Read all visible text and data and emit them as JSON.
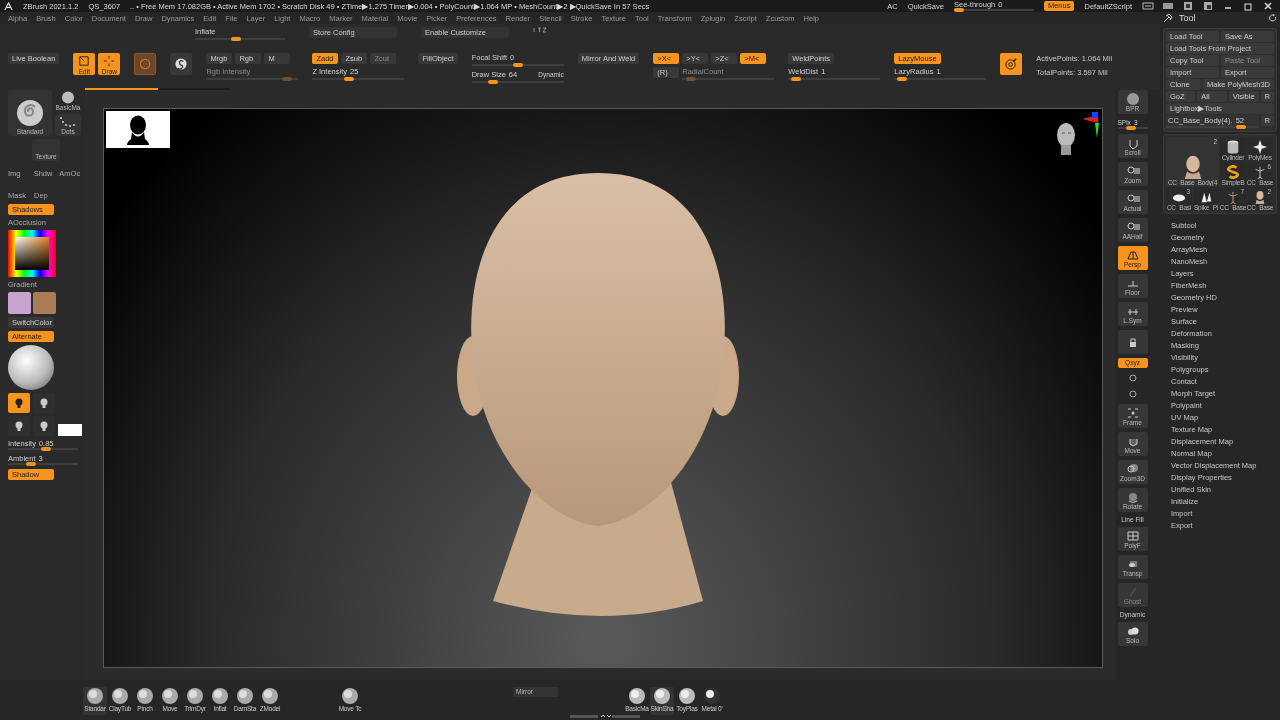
{
  "title_bar": {
    "items": [
      "ZBrush 2021.1.2",
      "QS_3607",
      "‥ • Free Mem 17.082GB • Active Mem 1702 • Scratch Disk 49 • ZTime▶1.275 Timer▶0.004 • PolyCount▶1.064 MP • MeshCount▶2 ▶QuickSave In 57 Secs"
    ],
    "right": [
      "AC",
      "QuickSave"
    ],
    "see_through": {
      "label": "See-through",
      "value": "0",
      "level": 0
    },
    "menus": {
      "label": "Menus",
      "on": true
    },
    "script": "DefaultZScript"
  },
  "menu": [
    "Alpha",
    "Brush",
    "Color",
    "Document",
    "Draw",
    "Dynamics",
    "Edit",
    "File",
    "Layer",
    "Light",
    "Macro",
    "Marker",
    "Material",
    "Movie",
    "Picker",
    "Preferences",
    "Render",
    "Stencil",
    "Stroke",
    "Texture",
    "Tool",
    "Transform",
    "Zplugin",
    "Zscript",
    "Zcustom",
    "Help"
  ],
  "toolbar": {
    "top_row": [
      {
        "kind": "slider",
        "label": "Inflate",
        "level": 0.45,
        "disabled": false
      },
      {
        "kind": "button",
        "label": "Store Config",
        "on": false,
        "disabled": false
      },
      {
        "kind": "button",
        "label": "Enable Customize",
        "on": false,
        "disabled": false
      }
    ],
    "groups": [
      {
        "rows": [
          [
            {
              "kind": "button",
              "label": "Live Boolean",
              "on": false,
              "disabled": false
            }
          ]
        ]
      },
      {
        "rows": [
          [
            {
              "kind": "tool",
              "label": "Edit",
              "on": true
            },
            {
              "kind": "tool",
              "label": "Draw",
              "on": true
            }
          ]
        ]
      },
      {
        "rows": [
          [
            {
              "kind": "tool",
              "on": false
            }
          ]
        ]
      },
      {
        "rows": [
          [
            {
              "kind": "tool",
              "on": false
            }
          ]
        ]
      },
      {
        "rows": [
          [
            {
              "kind": "button",
              "label": "Mrgb",
              "on": false,
              "disabled": false
            },
            {
              "kind": "button",
              "label": "Rgb",
              "on": false,
              "disabled": false
            },
            {
              "kind": "button",
              "label": "M",
              "on": false,
              "disabled": false
            }
          ],
          [
            {
              "kind": "slider",
              "label": "Rgb Intensity",
              "level": 0.92,
              "disabled": true
            }
          ]
        ]
      },
      {
        "rows": [
          [
            {
              "kind": "button",
              "label": "Zadd",
              "on": true,
              "disabled": false
            },
            {
              "kind": "button",
              "label": "Zsub",
              "on": false,
              "disabled": false
            },
            {
              "kind": "button",
              "label": "Zcut",
              "on": false,
              "disabled": true
            }
          ],
          [
            {
              "kind": "slider",
              "label": "Z Intensity",
              "value": "25",
              "level": 0.38,
              "disabled": false
            }
          ]
        ]
      },
      {
        "rows": [
          [
            {
              "kind": "button",
              "label": "FillObject",
              "on": false,
              "disabled": false
            }
          ]
        ]
      },
      {
        "rows": [
          [
            {
              "kind": "slider",
              "label": "Focal Shift",
              "value": "0",
              "level": 0.5,
              "disabled": false
            }
          ],
          [
            {
              "kind": "slider",
              "label": "Draw Size",
              "value": "64",
              "extra": "Dynamic",
              "level": 0.2,
              "disabled": false
            }
          ]
        ]
      },
      {
        "rows": [
          [
            {
              "kind": "button",
              "label": "Mirror And Weld",
              "on": false,
              "disabled": false
            }
          ]
        ]
      },
      {
        "rows": [
          [
            {
              "kind": "button",
              "label": ">X<",
              "on": true,
              "disabled": false
            },
            {
              "kind": "button",
              "label": ">Y<",
              "on": false,
              "disabled": false
            },
            {
              "kind": "button",
              "label": ">Z<",
              "on": false,
              "disabled": false
            },
            {
              "kind": "button",
              "label": ">M<",
              "on": true,
              "disabled": false
            }
          ],
          [
            {
              "kind": "button",
              "label": "(R)",
              "on": false,
              "disabled": false
            },
            {
              "kind": "slider",
              "label": "RadialCount",
              "level": 0.05,
              "disabled": true
            }
          ]
        ]
      },
      {
        "rows": [
          [
            {
              "kind": "button",
              "label": "WeldPoints",
              "on": false,
              "disabled": false
            }
          ],
          [
            {
              "kind": "slider",
              "label": "WeldDist",
              "value": "1",
              "level": 0.03,
              "disabled": false
            }
          ]
        ]
      },
      {
        "rows": [
          [
            {
              "kind": "button",
              "label": "LazyMouse",
              "on": true,
              "disabled": false
            }
          ],
          [
            {
              "kind": "slider",
              "label": "LazyRadius",
              "value": "1",
              "level": 0.03,
              "disabled": false
            }
          ]
        ]
      },
      {
        "rows": [
          [
            {
              "kind": "tool",
              "on": true
            }
          ]
        ]
      },
      {
        "rows": [
          [
            {
              "kind": "text",
              "label": "ActivePoints: 1.064 Mil"
            }
          ],
          [
            {
              "kind": "text",
              "label": "TotalPoints: 3.597 Mil"
            }
          ]
        ]
      }
    ],
    "progress": {
      "level": 0.5
    }
  },
  "left_shelf": {
    "brush_label": "Standard",
    "material_label": "BasicMa",
    "stroke_label": "Dots",
    "texture_label": "Texture",
    "modes": [
      {
        "label": "Img"
      },
      {
        "label": "Shdw"
      },
      {
        "label": "AmOc"
      },
      {
        "label": "Mask"
      },
      {
        "label": "Dep"
      }
    ],
    "shadows": {
      "label": "Shadows",
      "on": true
    },
    "aocclusion": "AOcclusion",
    "gradient": "Gradient",
    "swatches": [
      {
        "color": "#c9a3cf"
      },
      {
        "color": "#a87c55"
      }
    ],
    "switch_color": {
      "label": "SwitchColor",
      "on": false
    },
    "alternate": {
      "label": "Alternate",
      "on": true
    },
    "lights": [
      {
        "selected": true
      },
      {
        "selected": false
      },
      {
        "selected": false
      },
      {
        "selected": false
      }
    ],
    "intensity": {
      "label": "Intensity",
      "value": "0.85",
      "level": 0.55
    },
    "ambient": {
      "label": "Ambient",
      "value": "3",
      "level": 0.3
    },
    "shadow": {
      "label": "Shadow",
      "on": true
    }
  },
  "right_shelf": [
    {
      "kind": "button",
      "label": "BPR",
      "on": false,
      "disabled": false
    },
    {
      "kind": "slider",
      "label": "SPix",
      "value": "3",
      "level": 0.4
    },
    {
      "kind": "button",
      "label": "Scroll",
      "on": false,
      "disabled": false
    },
    {
      "kind": "button",
      "label": "Zoom",
      "on": false,
      "disabled": false
    },
    {
      "kind": "button",
      "label": "Actual",
      "on": false,
      "disabled": false
    },
    {
      "kind": "button",
      "label": "AAHalf",
      "on": false,
      "disabled": false
    },
    {
      "kind": "button",
      "label": "Persp",
      "on": true,
      "disabled": false
    },
    {
      "kind": "button",
      "label": "Floor",
      "on": false,
      "disabled": false
    },
    {
      "kind": "button",
      "label": "L.Sym",
      "on": false,
      "disabled": false
    },
    {
      "kind": "button",
      "on": false,
      "disabled": false
    },
    {
      "kind": "toggle",
      "label": "Qxyz",
      "on": true
    },
    {
      "kind": "icon"
    },
    {
      "kind": "icon"
    },
    {
      "kind": "button",
      "label": "Frame",
      "on": false,
      "disabled": false
    },
    {
      "kind": "button",
      "label": "Move",
      "on": false,
      "disabled": false
    },
    {
      "kind": "button",
      "label": "Zoom3D",
      "on": false,
      "disabled": false
    },
    {
      "kind": "button",
      "label": "Rotate",
      "on": false,
      "disabled": false
    },
    {
      "kind": "button",
      "label": "PolyF",
      "top_label": "Line Fill",
      "on": false,
      "disabled": false
    },
    {
      "kind": "button",
      "label": "Transp",
      "on": false,
      "disabled": false
    },
    {
      "kind": "button",
      "label": "Ghost",
      "on": false,
      "disabled": true
    },
    {
      "kind": "button",
      "label": "Solo",
      "top_label": "Dynamic",
      "on": false,
      "disabled": false
    }
  ],
  "tool_panel": {
    "title": "Tool",
    "button_rows": [
      [
        {
          "label": "Load Tool",
          "disabled": false
        },
        {
          "label": "Save As",
          "disabled": false
        }
      ],
      [
        {
          "label": "Load Tools From Project",
          "disabled": false
        }
      ],
      [
        {
          "label": "Copy Tool",
          "disabled": false
        },
        {
          "label": "Paste Tool",
          "disabled": true
        }
      ],
      [
        {
          "label": "Import",
          "disabled": false
        },
        {
          "label": "Export",
          "disabled": false
        }
      ],
      [
        {
          "label": "Clone",
          "disabled": false
        },
        {
          "label": "Make PolyMesh3D",
          "disabled": false
        }
      ],
      [
        {
          "label": "GoZ",
          "disabled": false
        },
        {
          "label": "All",
          "disabled": false
        },
        {
          "label": "Visible",
          "disabled": false
        },
        {
          "label": "R",
          "disabled": false
        }
      ],
      [
        {
          "label": "Lightbox▶Tools",
          "disabled": false
        }
      ]
    ],
    "slider": {
      "label": "CC_Base_Body(4).",
      "value": "52",
      "level": 0.85,
      "reset": "R"
    },
    "thumbnails": [
      {
        "label": "CC_Base_Body(4",
        "count": "2"
      },
      {
        "label": "Cylinder"
      },
      {
        "label": "PolyMes"
      },
      {
        "label": "SimpleB"
      },
      {
        "label": "CC_Base",
        "count": "6"
      },
      {
        "label": "CC_Basi",
        "count": "3"
      },
      {
        "label": "Spike_Pi"
      },
      {
        "label": "CC_Base",
        "count": "7"
      },
      {
        "label": "CC_Base",
        "count": "2"
      }
    ],
    "menu": [
      "Subtool",
      "Geometry",
      "ArrayMesh",
      "NanoMesh",
      "Layers",
      "FiberMesh",
      "Geometry HD",
      "Preview",
      "Surface",
      "Deformation",
      "Masking",
      "Visibility",
      "Polygroups",
      "Contact",
      "Morph Target",
      "Polypaint",
      "UV Map",
      "Texture Map",
      "Displacement Map",
      "Normal Map",
      "Vector Displacement Map",
      "Display Properties",
      "Unified Skin",
      "Initialize",
      "Import",
      "Export"
    ]
  },
  "bottom_shelf": {
    "brush_groups": [
      [
        {
          "label": "Standar",
          "selected": true
        },
        {
          "label": "ClayTub",
          "selected": false
        },
        {
          "label": "Pinch",
          "selected": false
        },
        {
          "label": "Move",
          "selected": false
        },
        {
          "label": "TrimDyr",
          "selected": false
        },
        {
          "label": "Inflat",
          "selected": false
        },
        {
          "label": "DamSta",
          "selected": false
        },
        {
          "label": "ZModel",
          "selected": false
        }
      ],
      [
        {
          "label": "Move Tc",
          "selected": false
        }
      ]
    ],
    "mirror": "Mirror",
    "materials": [
      {
        "label": "BasicMa",
        "selected": false
      },
      {
        "label": "SkinSha",
        "selected": true
      },
      {
        "label": "ToyPlas",
        "selected": false
      },
      {
        "label": "Metal 0'",
        "selected": false
      }
    ]
  }
}
